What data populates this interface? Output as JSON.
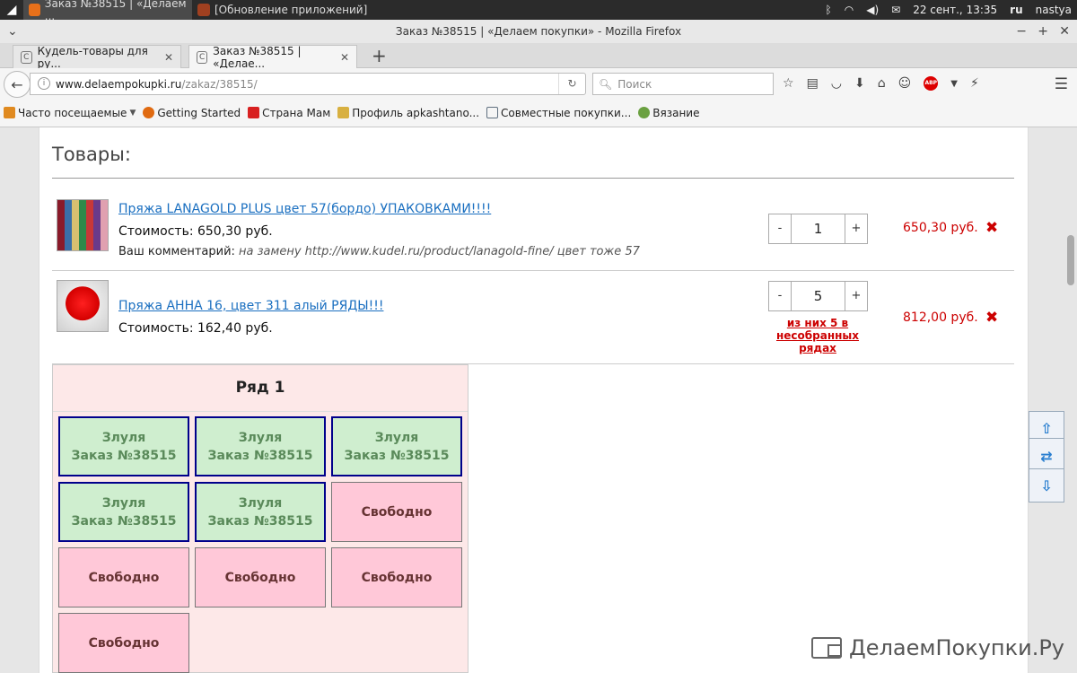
{
  "taskbar": {
    "tasks": [
      {
        "label": "Заказ №38515 | «Делаем ..."
      },
      {
        "label": "[Обновление приложений]"
      }
    ],
    "datetime": "22 сент., 13:35",
    "keyboard_layout": "ru",
    "user": "nastya"
  },
  "window": {
    "title": "Заказ №38515 | «Делаем покупки» - Mozilla Firefox"
  },
  "tabs": [
    {
      "label": "Кудель-товары для ру...",
      "selected": false
    },
    {
      "label": "Заказ №38515 | «Делае...",
      "selected": true
    }
  ],
  "navbar": {
    "url_host": "www.delaempokupki.ru",
    "url_path": "/zakaz/38515/",
    "search_placeholder": "Поиск"
  },
  "bookmarks": [
    {
      "label": "Часто посещаемые",
      "color": "#e08a20"
    },
    {
      "label": "Getting Started",
      "color": "#e06a10"
    },
    {
      "label": "Страна Мам",
      "color": "#d82020"
    },
    {
      "label": "Профиль apkashtano...",
      "color": "#d8b040"
    },
    {
      "label": "Совместные покупки...",
      "color": "#607080"
    },
    {
      "label": "Вязание",
      "color": "#6aa040"
    }
  ],
  "content": {
    "section_title": "Товары:",
    "items": [
      {
        "name": "Пряжа LANAGOLD PLUS цвет 57(бордо) УПАКОВКАМИ!!!!",
        "cost": "Стоимость: 650,30 руб.",
        "comment_label": "Ваш комментарий:",
        "comment": "на замену http://www.kudel.ru/product/lanagold-fine/ цвет тоже 57",
        "qty": "1",
        "total": "650,30 руб."
      },
      {
        "name": "Пряжа АННА 16, цвет 311 алый РЯДЫ!!!",
        "cost": "Стоимость: 162,40 руб.",
        "qty": "5",
        "total": "812,00 руб.",
        "note_line1": "из них 5 в",
        "note_line2": "несобранных",
        "note_line3": "рядах"
      }
    ],
    "qty_minus": "-",
    "qty_plus": "+",
    "delete_glyph": "✖",
    "row": {
      "title": "Ряд 1",
      "slots": [
        {
          "state": "busy",
          "line1": "Злуля",
          "line2": "Заказ №38515"
        },
        {
          "state": "busy",
          "line1": "Злуля",
          "line2": "Заказ №38515"
        },
        {
          "state": "busy",
          "line1": "Злуля",
          "line2": "Заказ №38515"
        },
        {
          "state": "busy",
          "line1": "Злуля",
          "line2": "Заказ №38515"
        },
        {
          "state": "busy",
          "line1": "Злуля",
          "line2": "Заказ №38515"
        },
        {
          "state": "free",
          "line1": "Свободно",
          "line2": ""
        },
        {
          "state": "free",
          "line1": "Свободно",
          "line2": ""
        },
        {
          "state": "free",
          "line1": "Свободно",
          "line2": ""
        },
        {
          "state": "free",
          "line1": "Свободно",
          "line2": ""
        },
        {
          "state": "free",
          "line1": "Свободно",
          "line2": ""
        }
      ]
    },
    "logo_text": "ДелаемПокупки.Ру"
  }
}
